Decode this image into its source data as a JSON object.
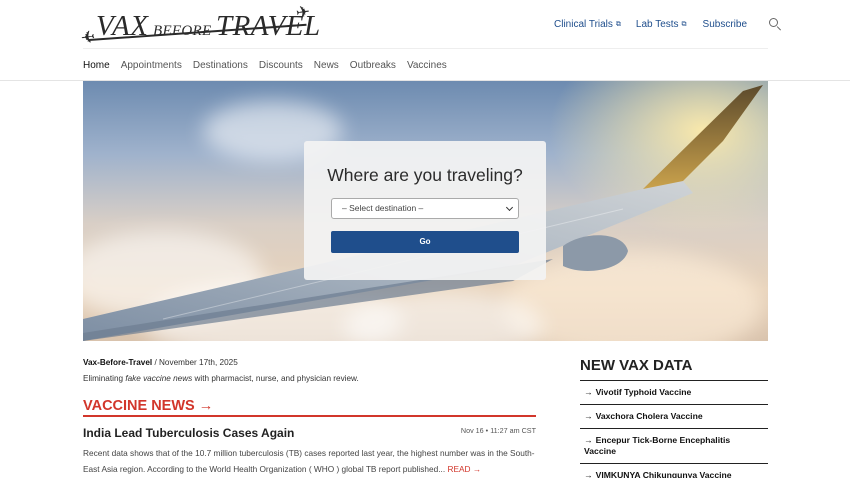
{
  "brand": {
    "logo_part1": "VAX",
    "logo_part2": "BEFORE",
    "logo_part3": "TRAVEL"
  },
  "top_links": [
    {
      "label": "Clinical Trials",
      "external": true
    },
    {
      "label": "Lab Tests",
      "external": true
    },
    {
      "label": "Subscribe",
      "external": false
    }
  ],
  "nav": [
    {
      "label": "Home",
      "active": true
    },
    {
      "label": "Appointments"
    },
    {
      "label": "Destinations"
    },
    {
      "label": "Discounts"
    },
    {
      "label": "News"
    },
    {
      "label": "Outbreaks"
    },
    {
      "label": "Vaccines"
    }
  ],
  "search": {
    "title": "Where are you traveling?",
    "select_value": "– Select destination –",
    "button_label": "Go"
  },
  "byline": {
    "author": "Vax-Before-Travel",
    "date": " / November 17th, 2025",
    "tagline_pre": "Eliminating ",
    "tagline_em": "fake vaccine news",
    "tagline_post": " with pharmacist, nurse, and physician review."
  },
  "news": {
    "section_title": "VACCINE NEWS →",
    "article_title": "India Lead Tuberculosis Cases Again",
    "article_time": "Nov 16 • 11:27 am CST",
    "article_body": "Recent data shows that of the 10.7 million tuberculosis (TB) cases reported last year, the highest number was in the South-East Asia region. According to the World Health Organization ( WHO ) global TB report published...",
    "read_more": "READ →"
  },
  "sidebar": {
    "title": "NEW VAX DATA",
    "items": [
      "Vivotif Typhoid Vaccine",
      "Vaxchora Cholera Vaccine",
      "Encepur Tick-Borne Encephalitis Vaccine",
      "VIMKUNYA Chikungunya Vaccine"
    ]
  },
  "colors": {
    "accent_blue": "#1f4e8c",
    "accent_red": "#d2362b"
  }
}
